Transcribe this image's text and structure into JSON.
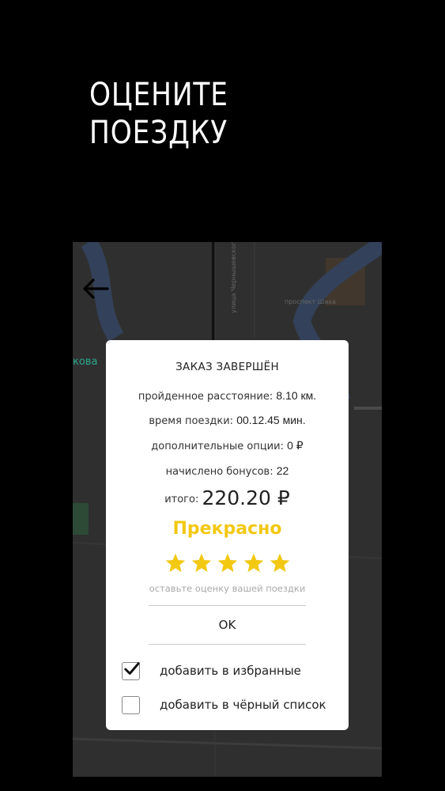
{
  "promo": {
    "line1": "ОЦЕНИТЕ",
    "line2": "ПОЕЗДКУ"
  },
  "map": {
    "street_1": "улица Чернышевского",
    "street_2": "проспект Шаха",
    "place_1": "кова"
  },
  "order_dialog": {
    "title": "ЗАКАЗ ЗАВЕРШЁН",
    "distance_label": "пройденное расстояние:",
    "distance_value": "8.10 км.",
    "time_label": "время поездки:",
    "time_value": "00.12.45 мин.",
    "options_label": "дополнительные опции:",
    "options_value": "0 ₽",
    "bonus_label": "начислено бонусов:",
    "bonus_value": "22",
    "total_label": "итого:",
    "total_value": "220.20 ₽",
    "rating_word": "Прекрасно",
    "rating": 5,
    "rating_max": 5,
    "rating_hint": "оставьте оценку вашей поездки",
    "ok_label": "OK",
    "favorite_label": "добавить в избранные",
    "favorite_checked": true,
    "blacklist_label": "добавить в чёрный список",
    "blacklist_checked": false
  },
  "colors": {
    "accent_yellow": "#f2c811",
    "background": "#000000",
    "dialog": "#ffffff"
  },
  "icons": {
    "back": "arrow-left-icon",
    "star": "star-icon",
    "check": "checkmark-icon"
  }
}
